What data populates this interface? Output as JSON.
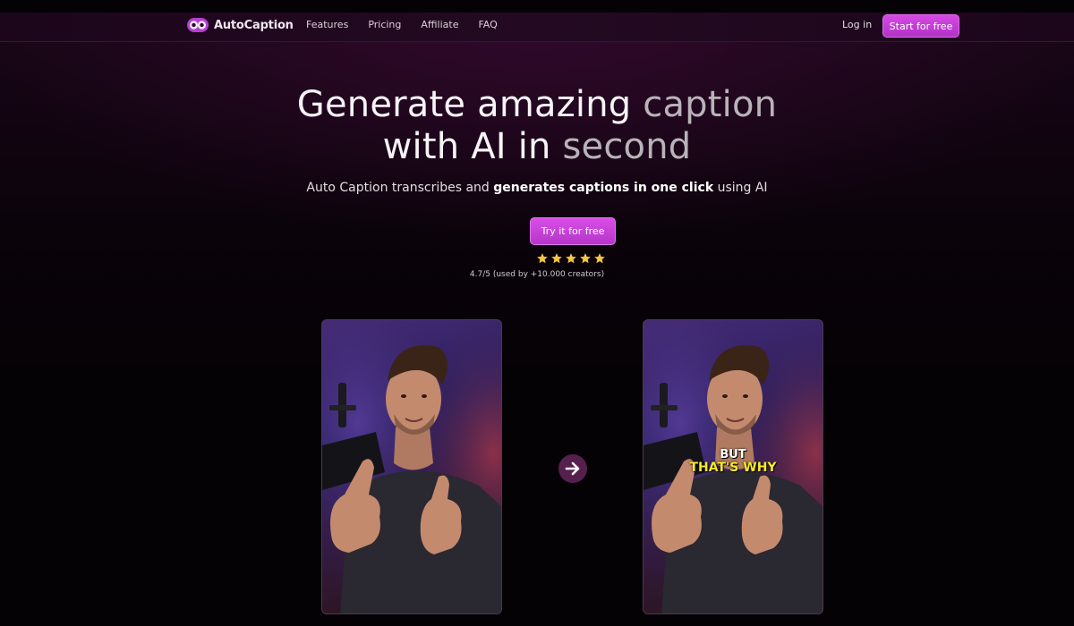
{
  "brand": {
    "name": "AutoCaption",
    "icon": "owl-logo-icon",
    "accent": "#c83fd9"
  },
  "nav": {
    "links": [
      "Features",
      "Pricing",
      "Affiliate",
      "FAQ"
    ],
    "login": "Log in",
    "start_button": "Start for free"
  },
  "hero": {
    "title_line1_bright": "Generate amazing ",
    "title_line1_dim": "caption",
    "title_line2_bright": "with AI in ",
    "title_line2_dim": "second",
    "subtitle_pre": "Auto Caption transcribes and ",
    "subtitle_bold": "generates captions in one click",
    "subtitle_post": " using AI",
    "cta": "Try it for free",
    "stars": 5,
    "rating_text": "4.7/5 (used by +10.000 creators)"
  },
  "demo": {
    "before_image": "creator-video-without-captions",
    "after_image": "creator-video-with-captions",
    "arrow_icon": "arrow-right-icon",
    "caption_line1": "BUT",
    "caption_line2": "THAT'S WHY"
  }
}
